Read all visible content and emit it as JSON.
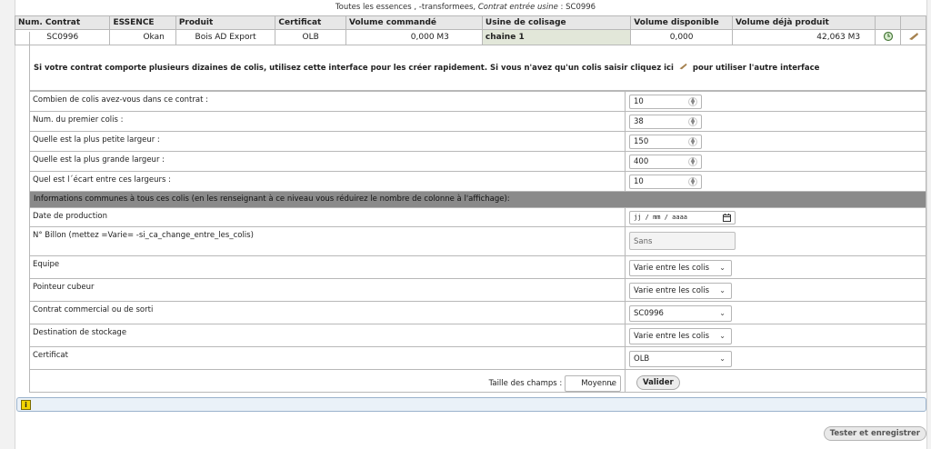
{
  "header": {
    "line_prefix": "Toutes les essences , -transformees,",
    "line_italic": "Contrat entrée usine",
    "line_suffix": ": SC0996"
  },
  "contract_table": {
    "columns": [
      "Num. Contrat",
      "ESSENCE",
      "Produit",
      "Certificat",
      "Volume commandé",
      "Usine de colisage",
      "Volume disponible",
      "Volume déjà produit"
    ],
    "row": {
      "num_contrat": "SC0996",
      "essence": "Okan",
      "produit": "Bois AD Export",
      "certificat": "OLB",
      "volume_commande": "0,000 M3",
      "usine": "chaine 1",
      "volume_disponible": "0,000",
      "volume_produit": "42,063 M3"
    }
  },
  "info": {
    "text_before": "Si votre contrat comporte plusieurs dizaines de colis, utilisez cette interface pour les créer rapidement. Si vous n'avez qu'un colis saisir cliquez ici",
    "text_after": "pour utiliser l'autre interface"
  },
  "form": {
    "nb_colis_label": "Combien de colis avez-vous dans ce contrat :",
    "nb_colis_value": "10",
    "premier_colis_label": "Num. du premier colis :",
    "premier_colis_value": "38",
    "petite_largeur_label": "Quelle est la plus petite largeur :",
    "petite_largeur_value": "150",
    "grande_largeur_label": "Quelle est la plus grande largeur :",
    "grande_largeur_value": "400",
    "ecart_label": "Quel est l´écart entre ces largeurs :",
    "ecart_value": "10",
    "section_title": "Informations communes à tous ces colis (en les renseignant à ce niveau vous réduirez le nombre de colonne à l'affichage):",
    "date_label": "Date de production",
    "date_placeholder": "jj / mm / aaaa",
    "billon_label": "N° Billon (mettez =Varie= -si_ca_change_entre_les_colis)",
    "billon_value": "Sans",
    "equipe_label": "Equipe",
    "equipe_value": "Varie entre les colis",
    "pointeur_label": "Pointeur cubeur",
    "pointeur_value": "Varie entre les colis",
    "contrat_label": "Contrat commercial ou de sorti",
    "contrat_value": "SC0996",
    "destination_label": "Destination de stockage",
    "destination_value": "Varie entre les colis",
    "certificat_label": "Certificat",
    "certificat_value": "OLB",
    "taille_label": "Taille des champs :",
    "taille_value": "Moyenne",
    "valider_label": "Valider"
  },
  "status": {
    "warning_icon": "i"
  },
  "footer": {
    "tester_label": "Tester et enregistrer"
  },
  "colors": {
    "section_bg": "#8a8a8a",
    "usine_bg": "#e2e7d9",
    "status_bg": "#eaf1f8",
    "warning": "#f2d400"
  }
}
